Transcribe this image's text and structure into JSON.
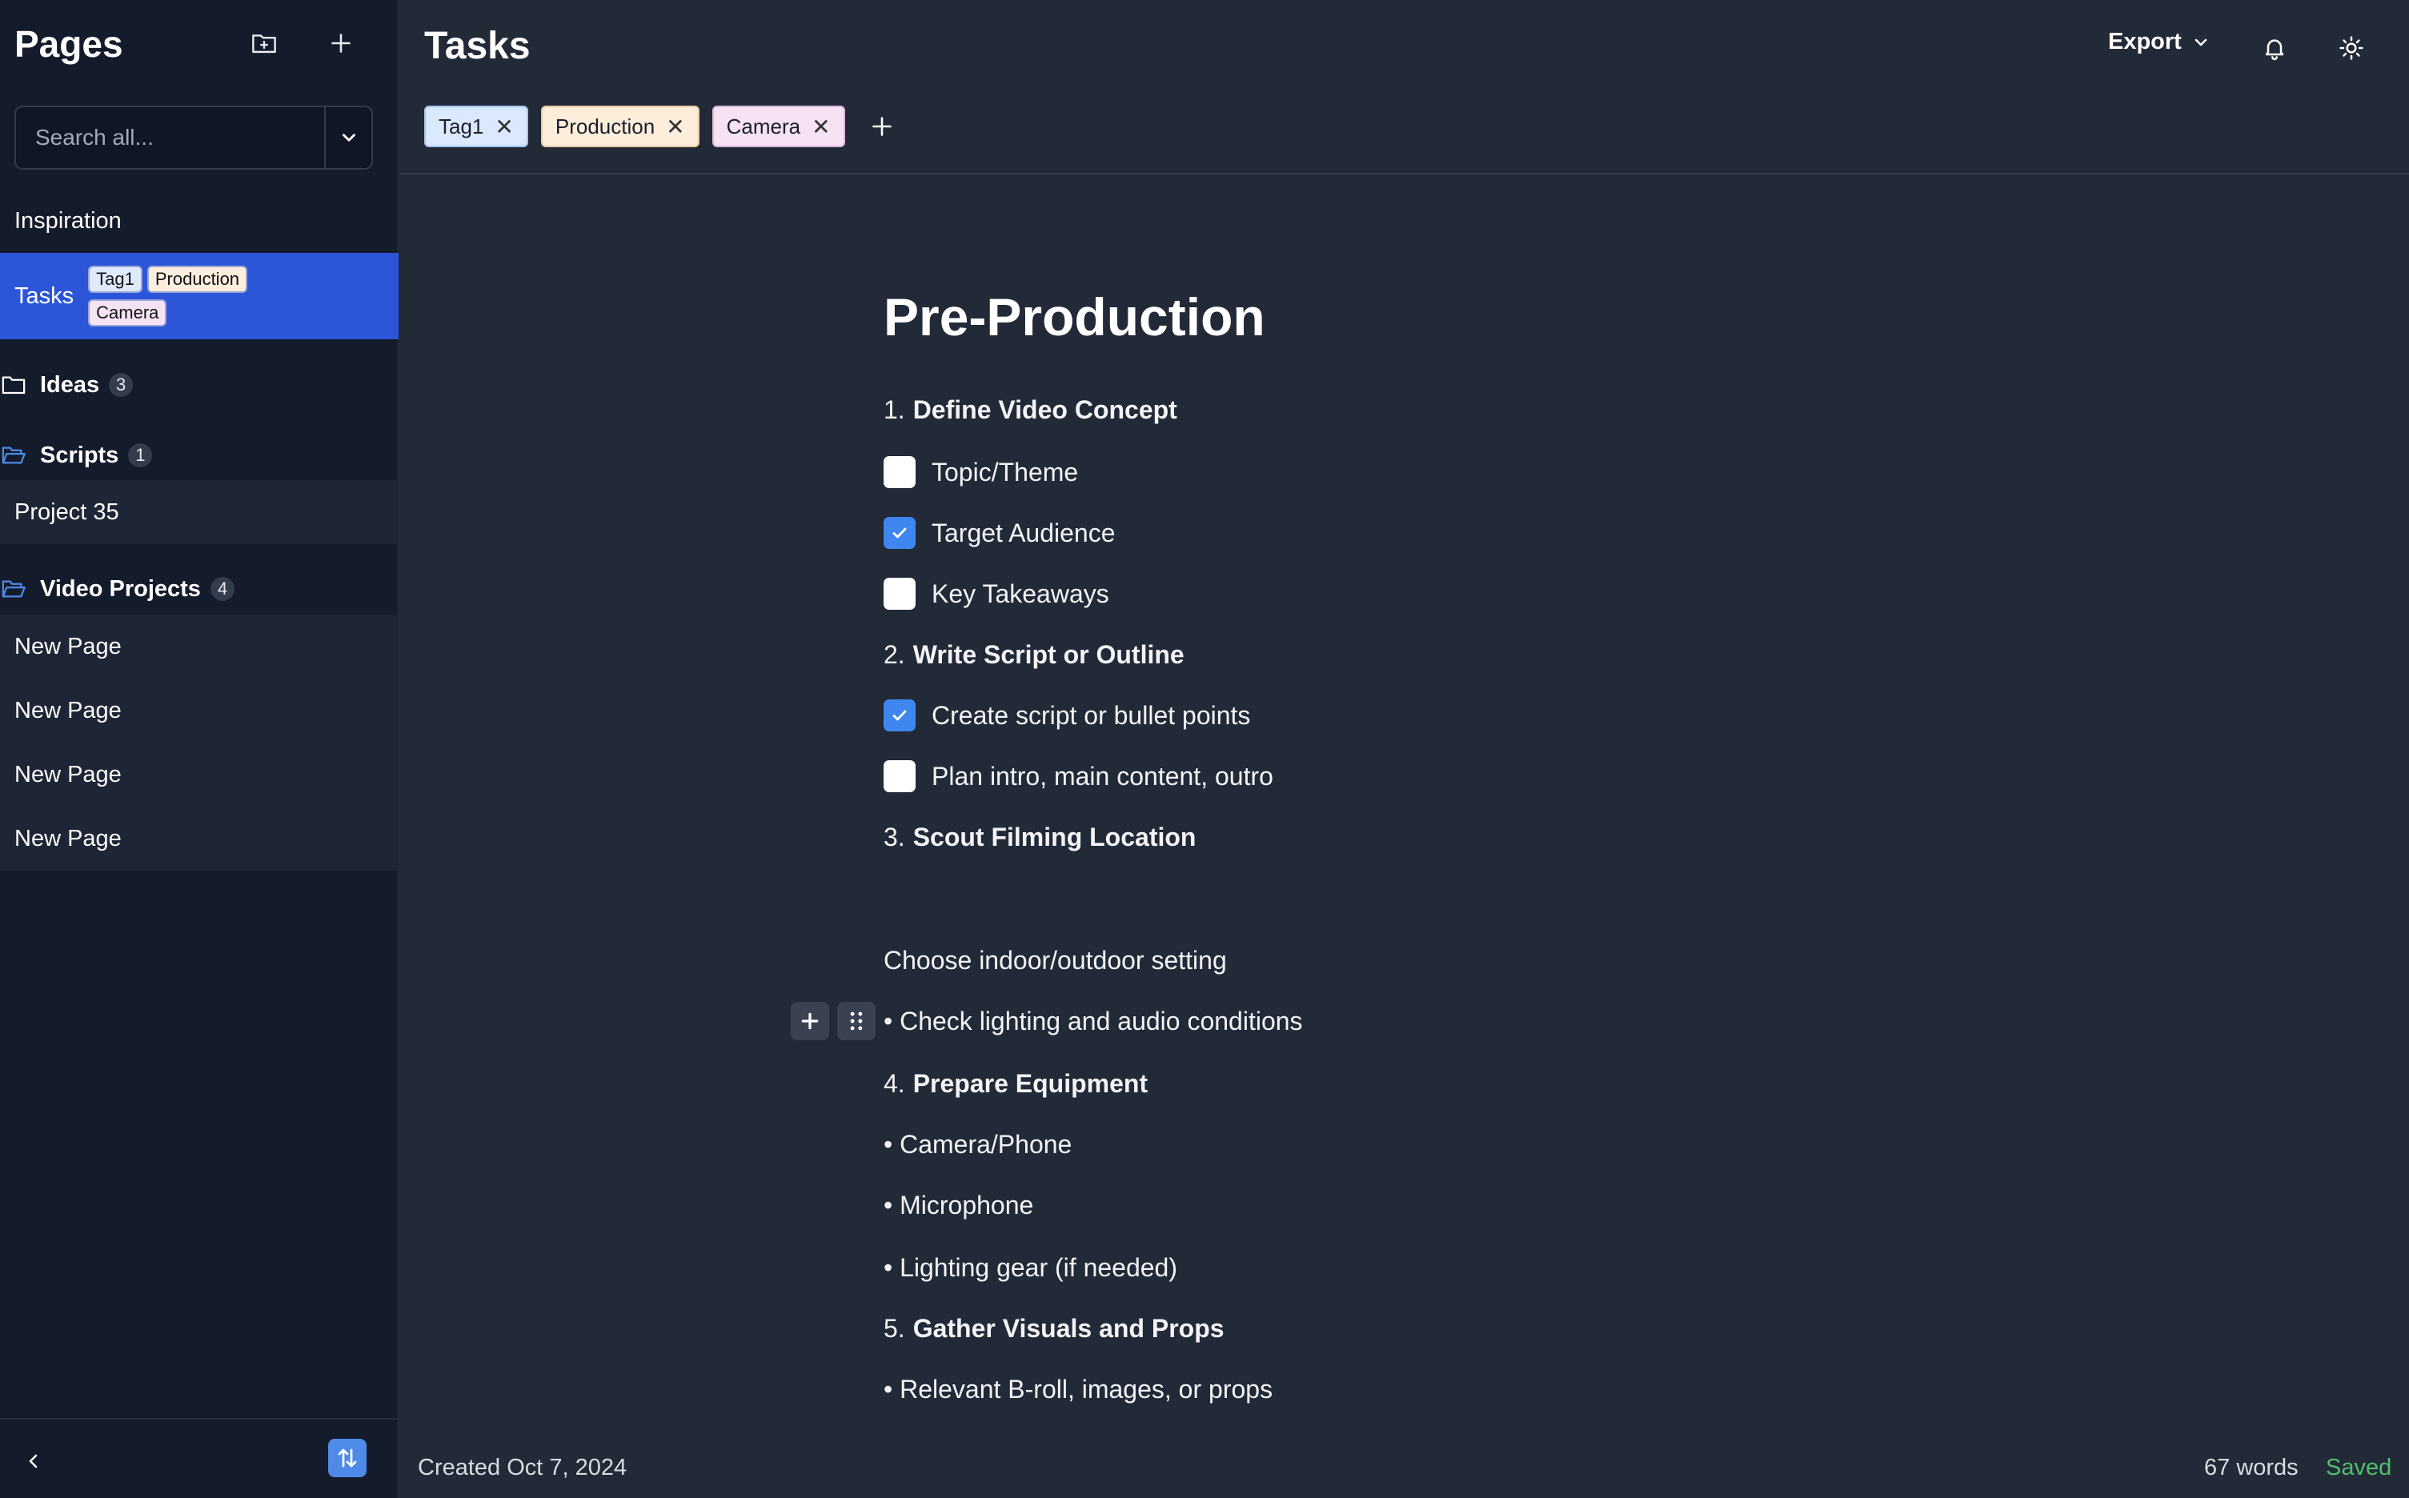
{
  "sidebar": {
    "title": "Pages",
    "search_placeholder": "Search all...",
    "items": [
      {
        "label": "Inspiration"
      },
      {
        "label": "Tasks",
        "tags": [
          "Tag1",
          "Production",
          "Camera"
        ]
      },
      {
        "label": "Ideas",
        "count": "3"
      },
      {
        "label": "Scripts",
        "count": "1"
      },
      {
        "label": "Project 35"
      },
      {
        "label": "Video Projects",
        "count": "4"
      },
      {
        "label": "New Page"
      },
      {
        "label": "New Page"
      },
      {
        "label": "New Page"
      },
      {
        "label": "New Page"
      }
    ]
  },
  "header": {
    "title": "Tasks",
    "export_label": "Export",
    "tags": [
      "Tag1",
      "Production",
      "Camera"
    ]
  },
  "document": {
    "title": "Pre-Production",
    "lines": [
      {
        "type": "numbered",
        "num": "1.",
        "text": "Define Video Concept"
      },
      {
        "type": "check",
        "checked": false,
        "text": "Topic/Theme"
      },
      {
        "type": "check",
        "checked": true,
        "text": "Target Audience"
      },
      {
        "type": "check",
        "checked": false,
        "text": "Key Takeaways"
      },
      {
        "type": "numbered",
        "num": "2.",
        "text": "Write Script or Outline"
      },
      {
        "type": "check",
        "checked": true,
        "text": "Create script or bullet points"
      },
      {
        "type": "check",
        "checked": false,
        "text": "Plan intro, main content, outro"
      },
      {
        "type": "numbered",
        "num": "3.",
        "text": "Scout Filming Location"
      },
      {
        "type": "text",
        "text": "Choose indoor/outdoor setting"
      },
      {
        "type": "text",
        "text": "• Check lighting and audio conditions"
      },
      {
        "type": "numbered",
        "num": "4.",
        "text": "Prepare Equipment"
      },
      {
        "type": "text",
        "text": "• Camera/Phone"
      },
      {
        "type": "text",
        "text": "• Microphone"
      },
      {
        "type": "text",
        "text": "• Lighting gear (if needed)"
      },
      {
        "type": "numbered",
        "num": "5.",
        "text": "Gather Visuals and Props"
      },
      {
        "type": "text",
        "text": "• Relevant B-roll, images, or props"
      }
    ]
  },
  "status": {
    "created": "Created Oct 7, 2024",
    "words": "67 words",
    "saved": "Saved"
  },
  "colors": {
    "accent": "#2c55d8",
    "checkbox_checked": "#3f86ef",
    "saved": "#4fbf6a"
  }
}
